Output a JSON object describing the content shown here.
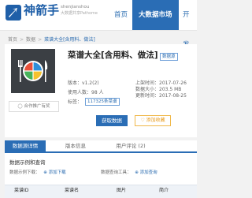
{
  "header": {
    "brand": "神箭手",
    "brand_pinyin": "shenjianshou",
    "brand_slogan": "大数据共享Pathome",
    "nav": [
      {
        "label": "首页"
      },
      {
        "label": "大数据市场"
      },
      {
        "label": "开发"
      }
    ]
  },
  "breadcrumb": [
    "首页",
    "数据",
    "菜谱大全[含用料、做法]"
  ],
  "product": {
    "title": "菜谱大全[含用料、做法]",
    "badge": "数据源",
    "version_label": "版本：",
    "version": "v1.2(2)",
    "online_label": "上架时间：",
    "online_date": "2017-07-26",
    "users_label": "使用人数：",
    "users": "98 人",
    "size_label": "数据大小：",
    "size": "203.5 MB",
    "update_label": "更新时间：",
    "update_date": "2017-08-25",
    "tag_label": "标签：",
    "tag": "117325条菜谱",
    "partner_label": "合作推广有奖",
    "get_button": "获取数据",
    "fav_button": "添加收藏"
  },
  "tabs": [
    {
      "label": "数据源详情"
    },
    {
      "label": "版本信息"
    },
    {
      "label": "用户评论 (2)"
    }
  ],
  "details": {
    "section_title": "数据示例和查询",
    "download_label": "数据示例下载：",
    "download_add": "添加下载",
    "query_label": "数据查询工具：",
    "query_add": "添加查询",
    "columns": [
      "菜谱ID",
      "菜谱名",
      "图片",
      "简介"
    ]
  },
  "colors": {
    "primary": "#2a6db5",
    "fav": "#e89a1a",
    "plate_quadrants": [
      "#e8503a",
      "#2f8fd9",
      "#47b35a",
      "#f5c12e"
    ]
  }
}
